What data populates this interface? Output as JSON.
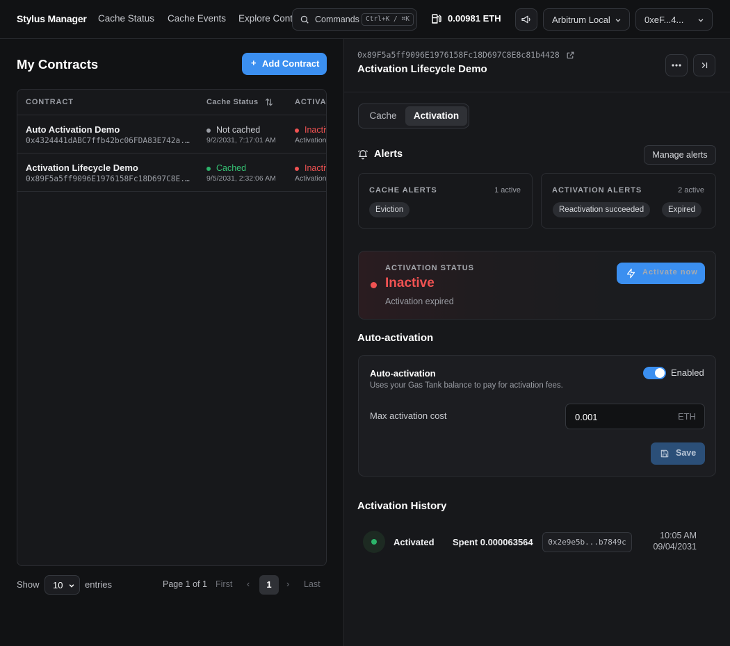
{
  "app": {
    "name": "Stylus Manager"
  },
  "nav": {
    "links": [
      "Cache Status",
      "Cache Events",
      "Explore Contracts"
    ],
    "commands_label": "Commands",
    "commands_shortcut": "Ctrl+K / ⌘K",
    "gas_balance": "0.00981 ETH",
    "network": "Arbitrum Local",
    "account": "0xeF...4..."
  },
  "left": {
    "title": "My Contracts",
    "add_button": "Add Contract",
    "columns": [
      "CONTRACT",
      "Cache Status",
      "ACTIVATION"
    ],
    "rows": [
      {
        "name": "Auto Activation Demo",
        "address": "0x4324441dABC7ffb42bc06FDA83E742a...",
        "cache_status": "Not cached",
        "cache_date": "9/2/2031, 7:17:01 AM",
        "activation": "Inactive",
        "activation_sub": "Activation expired"
      },
      {
        "name": "Activation Lifecycle Demo",
        "address": "0x89F5a5ff9096E1976158Fc18D697C8E...",
        "cache_status": "Cached",
        "cache_date": "9/5/2031, 2:32:06 AM",
        "activation": "Inactive",
        "activation_sub": "Activation expired"
      }
    ],
    "pager": {
      "show": "Show",
      "page_size": "10",
      "entries": "entries",
      "page_of": "Page 1 of 1",
      "first": "First",
      "prev": "‹",
      "current": "1",
      "next": "›",
      "last": "Last"
    }
  },
  "detail": {
    "address": "0x89F5a5ff9096E1976158Fc18D697C8E8c81b4428",
    "title": "Activation Lifecycle Demo",
    "tabs": [
      "Cache",
      "Activation"
    ],
    "alerts": {
      "title": "Alerts",
      "manage_button": "Manage alerts",
      "cache": {
        "label": "CACHE ALERTS",
        "count": "1 active",
        "pills": [
          "Eviction"
        ]
      },
      "activation": {
        "label": "ACTIVATION ALERTS",
        "count": "2 active",
        "pills": [
          "Reactivation succeeded",
          "Expired"
        ]
      }
    },
    "status": {
      "label": "ACTIVATION STATUS",
      "value": "Inactive",
      "sub": "Activation expired",
      "button": "Activate now"
    },
    "auto": {
      "section_title": "Auto-activation",
      "title": "Auto-activation",
      "description": "Uses your Gas Tank balance to pay for activation fees.",
      "toggle_label": "Enabled",
      "enabled": true,
      "max_cost_label": "Max activation cost",
      "max_cost_value": "0.001",
      "max_cost_unit": "ETH",
      "save": "Save"
    },
    "history": {
      "title": "Activation History",
      "items": [
        {
          "event": "Activated",
          "spent": "Spent 0.000063564",
          "tx": "0x2e9e5b...b7849c",
          "time": "10:05 AM",
          "date": "09/04/2031"
        }
      ]
    }
  },
  "colors": {
    "accent": "#3b8ff0",
    "inactive": "#f05252",
    "cached": "#2cb46a",
    "not_cached": "#9a9da4"
  }
}
